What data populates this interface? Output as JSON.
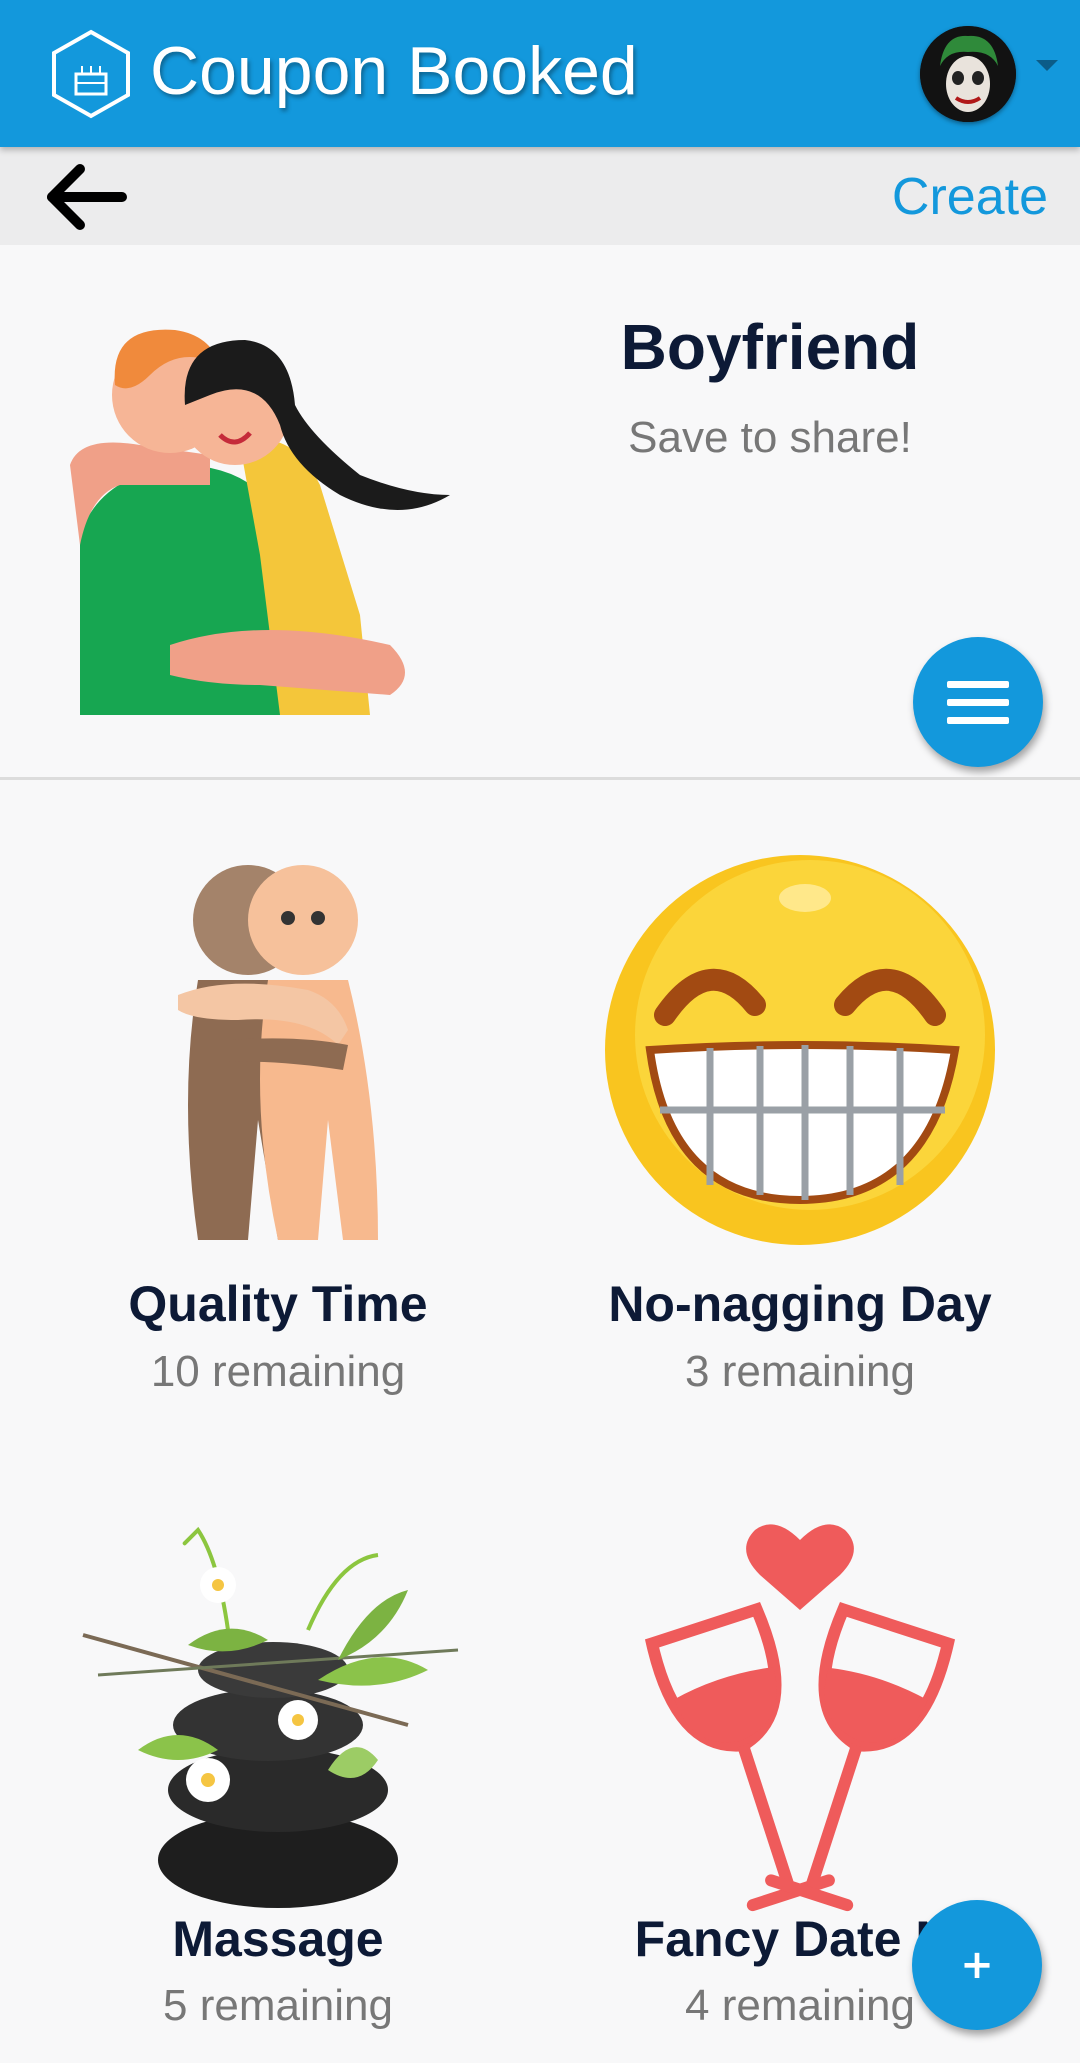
{
  "app": {
    "title": "Coupon Booked",
    "logo_icon": "cake-hexagon-icon",
    "avatar_icon": "joker-avatar",
    "accent_color": "#1398dc"
  },
  "toolbar": {
    "back_icon": "arrow-left-icon",
    "create_label": "Create"
  },
  "book": {
    "title": "Boyfriend",
    "subtitle": "Save to share!",
    "image_icon": "hugging-couple-illustration",
    "menu_icon": "hamburger-menu-icon"
  },
  "coupons": [
    {
      "title": "Quality Time",
      "remaining": "10 remaining",
      "icon": "hugging-figures-icon"
    },
    {
      "title": "No-nagging Day",
      "remaining": "3 remaining",
      "icon": "grinning-face-icon"
    },
    {
      "title": "Massage",
      "remaining": "5 remaining",
      "icon": "spa-stones-icon"
    },
    {
      "title": "Fancy Date Ni",
      "remaining": "4 remaining",
      "icon": "wine-glasses-heart-icon"
    }
  ],
  "add_button": {
    "label": "+"
  }
}
